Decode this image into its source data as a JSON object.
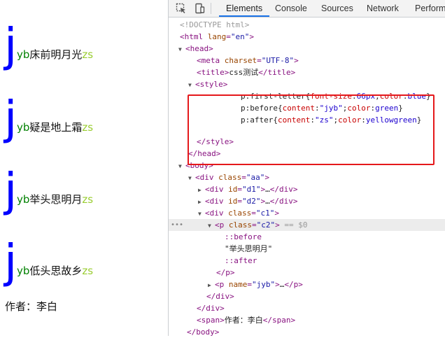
{
  "page": {
    "lines": [
      {
        "first": "j",
        "before": "yb",
        "rest": "床前明月光",
        "after": "zs"
      },
      {
        "first": "j",
        "before": "yb",
        "rest": "疑是地上霜",
        "after": "zs"
      },
      {
        "first": "j",
        "before": "yb",
        "rest": "举头思明月",
        "after": "zs"
      },
      {
        "first": "j",
        "before": "yb",
        "rest": "低头思故乡",
        "after": "zs"
      }
    ],
    "author": "作者：李白"
  },
  "devtools": {
    "tabs": [
      "Elements",
      "Console",
      "Sources",
      "Network",
      "Performa"
    ],
    "active_tab": "Elements",
    "dom": {
      "doctype": "<!DOCTYPE html>",
      "html_open": "<html",
      "lang_attr": "lang",
      "lang_val": "\"en\"",
      "head": "<head>",
      "meta_open": "<meta",
      "charset_attr": "charset",
      "charset_val": "\"UTF-8\"",
      "title_open": "<title>",
      "title_text": "css测试",
      "title_close": "</title>",
      "style_open": "<style>",
      "css1_sel": "p:first-letter{",
      "css1_p1": "font-size",
      "css1_v1": "66px",
      "css1_p2": "color",
      "css1_v2": "blue",
      "css2_sel": "p:before{",
      "css2_p1": "content",
      "css2_v1": "\"jyb\"",
      "css2_p2": "color",
      "css2_v2": "green",
      "css3_sel": "p:after{",
      "css3_p1": "content",
      "css3_v1": "\"zs\"",
      "css3_p2": "color",
      "css3_v2": "yellowgreen",
      "style_close": "</style>",
      "head_close": "</head>",
      "body_open": "<body>",
      "div_aa_open": "<div",
      "class_attr": "class",
      "aa_val": "\"aa\"",
      "id_attr": "id",
      "d1_val": "\"d1\"",
      "d2_val": "\"d2\"",
      "ellipsis": "…",
      "div_close": "</div>",
      "c1_val": "\"c1\"",
      "p_open": "<p",
      "c2_val": "\"c2\"",
      "eq0": "== $0",
      "before_pseudo": "::before",
      "p_text": "\"举头思明月\"",
      "after_pseudo": "::after",
      "p_close": "</p>",
      "name_attr": "name",
      "jyb_val": "\"jyb\"",
      "span_open": "<span>",
      "span_text": "作者：李白",
      "span_close": "</span>",
      "body_close": "</body>"
    }
  },
  "colors": {
    "first_letter": "#0000ff",
    "before": "#008000",
    "after": "#9acd32",
    "highlight_box": "#e5181b",
    "active_tab_underline": "#1a73e8"
  }
}
